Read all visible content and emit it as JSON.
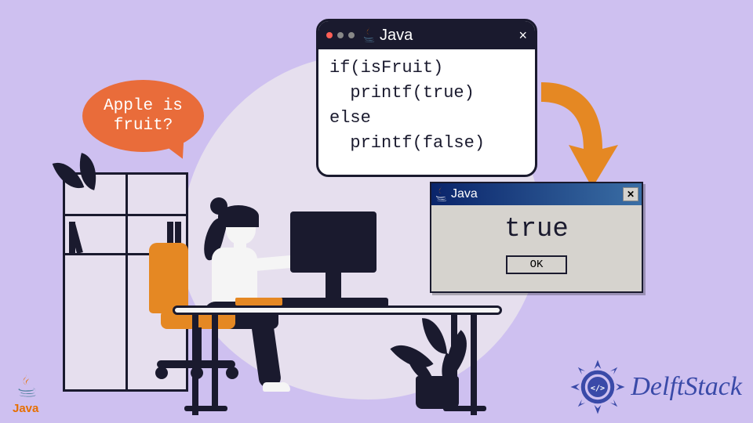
{
  "speech_text": "Apple is fruit?",
  "code_window": {
    "title": "Java",
    "lines": "if(isFruit)\n  printf(true)\nelse\n  printf(false)"
  },
  "dialog": {
    "title": "Java",
    "body": "true",
    "ok_label": "OK"
  },
  "java_logo_text": "Java",
  "brand": "DelftStack"
}
